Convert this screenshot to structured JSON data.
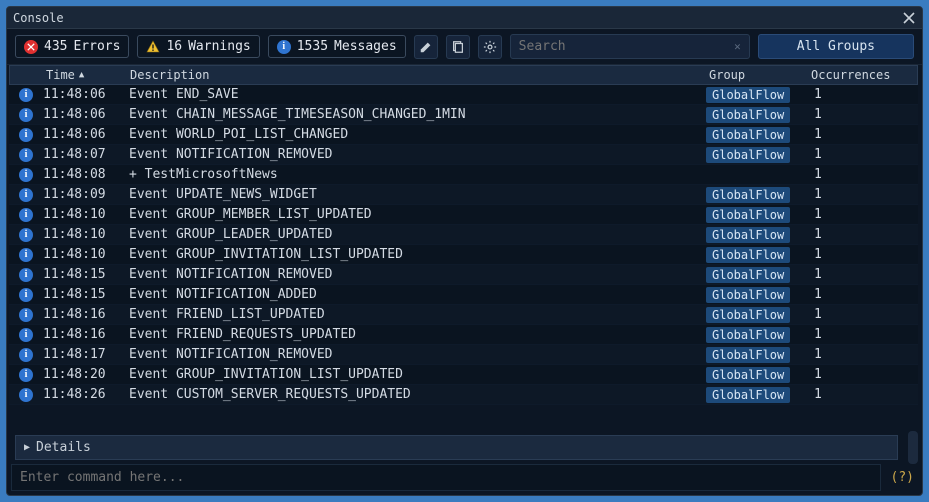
{
  "window": {
    "title": "Console"
  },
  "toolbar": {
    "errors_count": "435",
    "errors_label": "Errors",
    "warnings_count": "16",
    "warnings_label": "Warnings",
    "messages_count": "1535",
    "messages_label": "Messages",
    "search_placeholder": "Search",
    "groups_label": "All Groups"
  },
  "columns": {
    "time": "Time",
    "description": "Description",
    "group": "Group",
    "occurrences": "Occurrences"
  },
  "rows": [
    {
      "time": "11:48:06",
      "desc": "Event END_SAVE",
      "group": "GlobalFlow",
      "occ": "1"
    },
    {
      "time": "11:48:06",
      "desc": "Event CHAIN_MESSAGE_TIMESEASON_CHANGED_1MIN",
      "group": "GlobalFlow",
      "occ": "1"
    },
    {
      "time": "11:48:06",
      "desc": "Event WORLD_POI_LIST_CHANGED",
      "group": "GlobalFlow",
      "occ": "1"
    },
    {
      "time": "11:48:07",
      "desc": "Event NOTIFICATION_REMOVED",
      "group": "GlobalFlow",
      "occ": "1"
    },
    {
      "time": "11:48:08",
      "desc": "+ TestMicrosoftNews",
      "group": "",
      "occ": "1"
    },
    {
      "time": "11:48:09",
      "desc": "Event UPDATE_NEWS_WIDGET",
      "group": "GlobalFlow",
      "occ": "1"
    },
    {
      "time": "11:48:10",
      "desc": "Event GROUP_MEMBER_LIST_UPDATED",
      "group": "GlobalFlow",
      "occ": "1"
    },
    {
      "time": "11:48:10",
      "desc": "Event GROUP_LEADER_UPDATED",
      "group": "GlobalFlow",
      "occ": "1"
    },
    {
      "time": "11:48:10",
      "desc": "Event GROUP_INVITATION_LIST_UPDATED",
      "group": "GlobalFlow",
      "occ": "1"
    },
    {
      "time": "11:48:15",
      "desc": "Event NOTIFICATION_REMOVED",
      "group": "GlobalFlow",
      "occ": "1"
    },
    {
      "time": "11:48:15",
      "desc": "Event NOTIFICATION_ADDED",
      "group": "GlobalFlow",
      "occ": "1"
    },
    {
      "time": "11:48:16",
      "desc": "Event FRIEND_LIST_UPDATED",
      "group": "GlobalFlow",
      "occ": "1"
    },
    {
      "time": "11:48:16",
      "desc": "Event FRIEND_REQUESTS_UPDATED",
      "group": "GlobalFlow",
      "occ": "1"
    },
    {
      "time": "11:48:17",
      "desc": "Event NOTIFICATION_REMOVED",
      "group": "GlobalFlow",
      "occ": "1"
    },
    {
      "time": "11:48:20",
      "desc": "Event GROUP_INVITATION_LIST_UPDATED",
      "group": "GlobalFlow",
      "occ": "1"
    },
    {
      "time": "11:48:26",
      "desc": "Event CUSTOM_SERVER_REQUESTS_UPDATED",
      "group": "GlobalFlow",
      "occ": "1"
    }
  ],
  "details": {
    "label": "Details"
  },
  "command": {
    "placeholder": "Enter command here...",
    "help": "(?)"
  }
}
